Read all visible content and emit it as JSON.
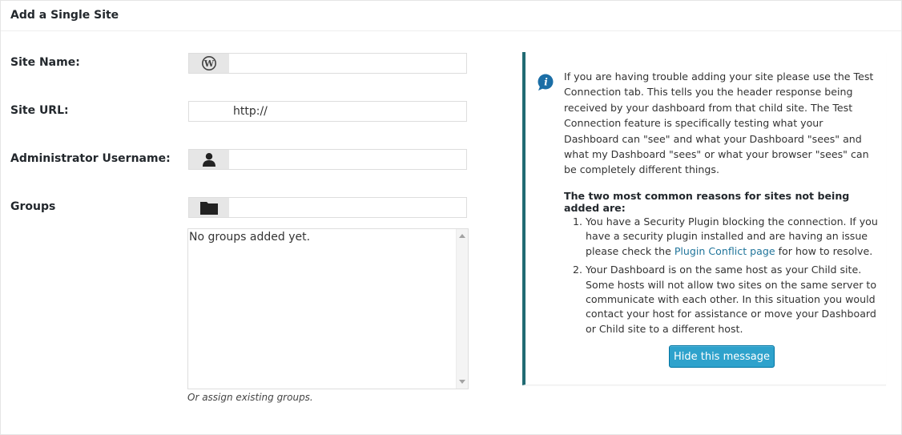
{
  "panel": {
    "title": "Add a Single Site"
  },
  "form": {
    "site_name": {
      "label": "Site Name:",
      "value": "",
      "icon": "wordpress-icon"
    },
    "site_url": {
      "label": "Site URL:",
      "prefix": "http://",
      "value": ""
    },
    "admin_username": {
      "label": "Administrator Username:",
      "value": "",
      "icon": "user-icon"
    },
    "groups": {
      "label": "Groups",
      "value": "",
      "icon": "folder-icon",
      "list_empty_text": "No groups added yet.",
      "hint": "Or assign existing groups."
    }
  },
  "notice": {
    "icon": "info-icon",
    "paragraph": "If you are having trouble adding your site please use the Test Connection tab. This tells you the header response being received by your dashboard from that child site. The Test Connection feature is specifically testing what your Dashboard can \"see\" and what your Dashboard \"sees\" and what my Dashboard \"sees\" or what your browser \"sees\" can be completely different things.",
    "heading": "The two most common reasons for sites not being added are:",
    "items": [
      {
        "num": "1.",
        "before": "You have a Security Plugin blocking the connection. If you have a security plugin installed and are having an issue please check the ",
        "link": "Plugin Conflict page",
        "after": " for how to resolve."
      },
      {
        "num": "2.",
        "text": "Your Dashboard is on the same host as your Child site. Some hosts will not allow two sites on the same server to communicate with each other. In this situation you would contact your host for assistance or move your Dashboard or Child site to a different host."
      }
    ],
    "hide_button": "Hide this message"
  },
  "colors": {
    "notice_border": "#216b73",
    "button": "#2ea2cc",
    "link": "#21759b",
    "info_icon": "#1b6ea6"
  }
}
